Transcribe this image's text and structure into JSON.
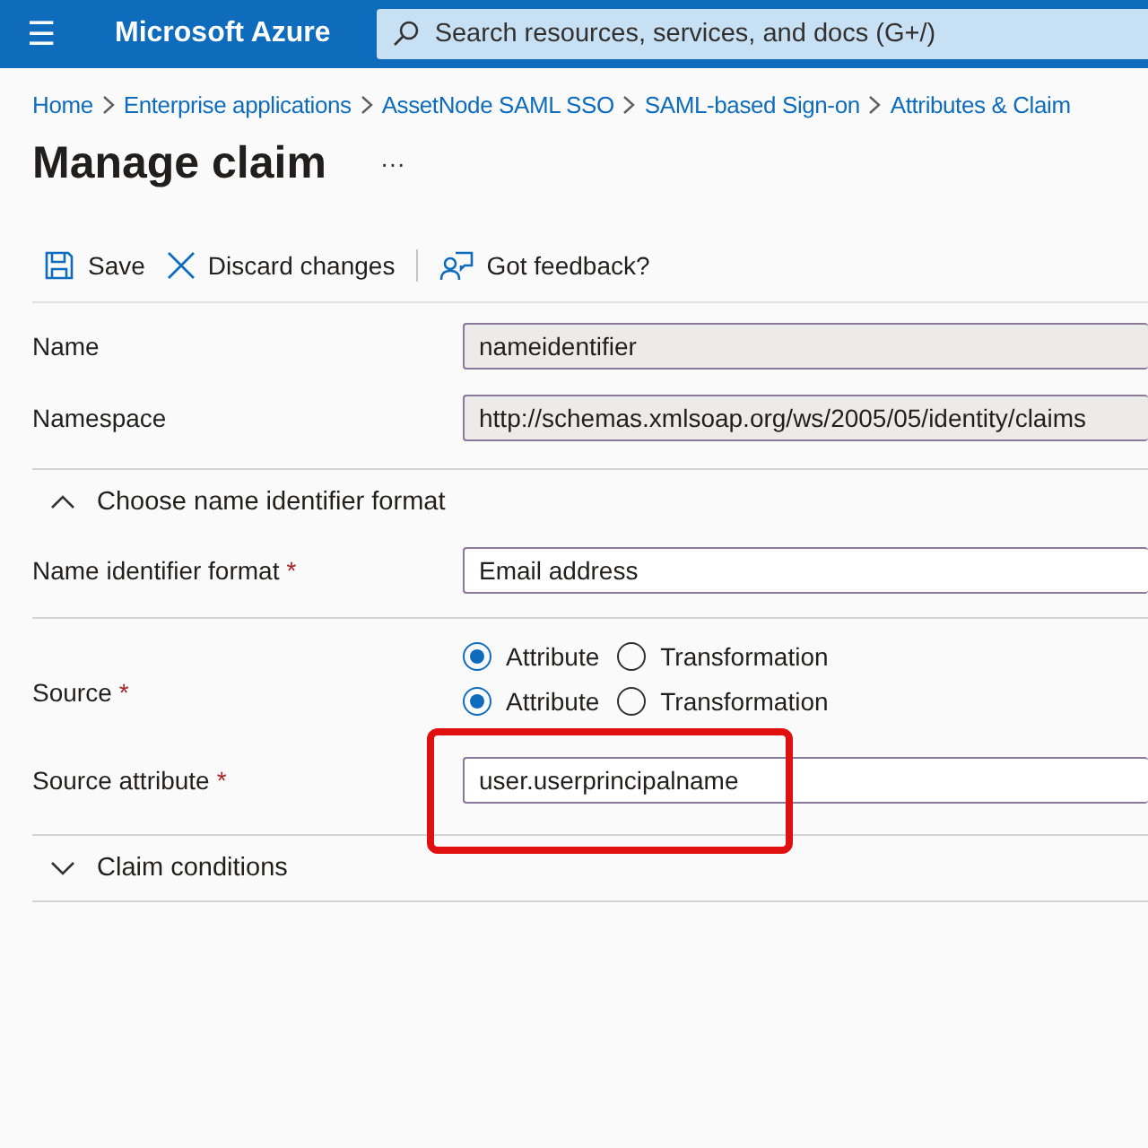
{
  "header": {
    "menu": "☰",
    "app_title": "Microsoft Azure",
    "search": {
      "placeholder": "Search resources, services, and docs (G+/)"
    }
  },
  "breadcrumb": [
    "Home",
    "Enterprise applications",
    "AssetNode SAML SSO",
    "SAML-based Sign-on",
    "Attributes & Claim"
  ],
  "page_title": "Manage claim",
  "more": "···",
  "toolbar": [
    {
      "kind": "save",
      "label": "Save"
    },
    {
      "kind": "discard",
      "label": "Discard changes"
    },
    {
      "kind": "feedback",
      "label": "Got feedback?"
    }
  ],
  "fields": [
    {
      "label": "Name",
      "value": "nameidentifier",
      "disabled": true
    },
    {
      "label": "Namespace",
      "value": "http://schemas.xmlsoap.org/ws/2005/05/identity/claims",
      "disabled": true
    }
  ],
  "format_section": {
    "title": "Choose name identifier format",
    "expanded": true,
    "field": {
      "label": "Name identifier format",
      "required_mark": "*",
      "value": "Email address",
      "disabled": false
    }
  },
  "source": {
    "label": "Source",
    "required_mark": "*",
    "rows": [
      [
        {
          "label": "Attribute",
          "selected": true
        },
        {
          "label": "Transformation",
          "selected": false
        }
      ],
      [
        {
          "label": "Attribute",
          "selected": true
        },
        {
          "label": "Transformation",
          "selected": false
        }
      ]
    ]
  },
  "source_attribute": {
    "label": "Source attribute",
    "required_mark": "*",
    "value": "user.userprincipalname",
    "disabled": false,
    "highlighted": true
  },
  "conditions_section": {
    "title": "Claim conditions",
    "expanded": false
  }
}
